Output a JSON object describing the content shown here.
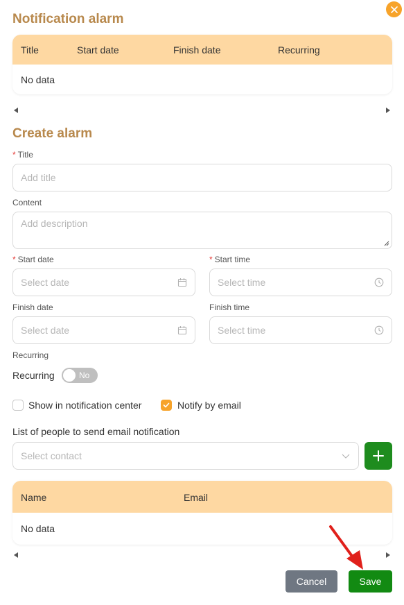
{
  "notification_alarm": {
    "title": "Notification alarm",
    "columns": [
      "Title",
      "Start date",
      "Finish date",
      "Recurring"
    ],
    "empty_text": "No data"
  },
  "create_alarm": {
    "title": "Create alarm",
    "title_field": {
      "label": "Title",
      "placeholder": "Add title"
    },
    "content_field": {
      "label": "Content",
      "placeholder": "Add description"
    },
    "start_date": {
      "label": "Start date",
      "placeholder": "Select date"
    },
    "start_time": {
      "label": "Start time",
      "placeholder": "Select time"
    },
    "finish_date": {
      "label": "Finish date",
      "placeholder": "Select date"
    },
    "finish_time": {
      "label": "Finish time",
      "placeholder": "Select time"
    },
    "recurring_label": "Recurring",
    "recurring_toggle_label": "Recurring",
    "recurring_toggle_state": "No",
    "show_in_notification_center": {
      "label": "Show in notification center",
      "checked": false
    },
    "notify_by_email": {
      "label": "Notify by email",
      "checked": true
    },
    "contacts_label": "List of people to send email notification",
    "contact_select_placeholder": "Select contact"
  },
  "contacts_table": {
    "columns": [
      "Name",
      "Email"
    ],
    "empty_text": "No data"
  },
  "actions": {
    "cancel": "Cancel",
    "save": "Save"
  },
  "colors": {
    "accent": "#f7a32a",
    "header_bg": "#fed8a2",
    "title_color": "#b8894d",
    "save_bg": "#128a12",
    "cancel_bg": "#6f7782",
    "annotation_arrow": "#e0201b"
  },
  "icons": [
    "close-icon",
    "calendar-icon",
    "clock-icon",
    "chevron-down-icon",
    "plus-icon",
    "check-icon"
  ]
}
